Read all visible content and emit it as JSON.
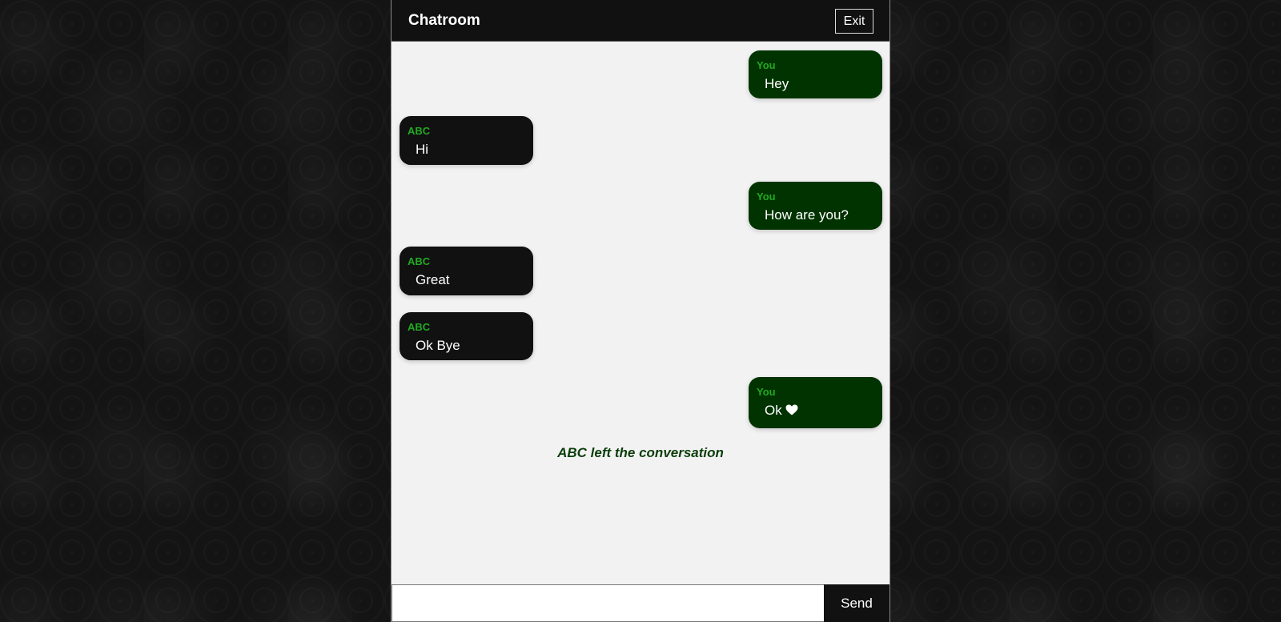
{
  "header": {
    "title": "Chatroom",
    "exit_label": "Exit"
  },
  "messages": [
    {
      "sender": "You",
      "text": "Hey",
      "mine": true
    },
    {
      "sender": "ABC",
      "text": "Hi",
      "mine": false
    },
    {
      "sender": "You",
      "text": "How are you?",
      "mine": true
    },
    {
      "sender": "ABC",
      "text": "Great",
      "mine": false
    },
    {
      "sender": "ABC",
      "text": "Ok Bye",
      "mine": false
    },
    {
      "sender": "You",
      "text": "Ok",
      "mine": true,
      "icon": "heart-icon"
    }
  ],
  "system_note": "ABC left the conversation",
  "composer": {
    "input_value": "",
    "send_label": "Send"
  },
  "colors": {
    "own_bubble": "#003300",
    "other_bubble": "#111111",
    "sender_label": "#22aa22",
    "system_note": "#0a3d0a"
  }
}
